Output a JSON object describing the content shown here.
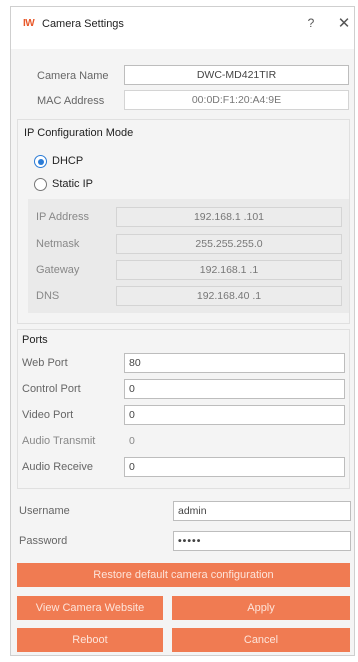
{
  "window": {
    "logo": "IW",
    "title": "Camera Settings",
    "help_glyph": "?",
    "close_glyph": "✕"
  },
  "camera": {
    "name_label": "Camera Name",
    "name_value": "DWC-MD421TIR",
    "mac_label": "MAC Address",
    "mac_value": "00:0D:F1:20:A4:9E"
  },
  "ip_config": {
    "title": "IP Configuration Mode",
    "dhcp_label": "DHCP",
    "static_label": "Static IP",
    "selected": "DHCP",
    "fields": [
      {
        "label": "IP Address",
        "value": "192.168.1 .101"
      },
      {
        "label": "Netmask",
        "value": "255.255.255.0"
      },
      {
        "label": "Gateway",
        "value": "192.168.1 .1"
      },
      {
        "label": "DNS",
        "value": "192.168.40 .1"
      }
    ]
  },
  "ports": {
    "title": "Ports",
    "items": [
      {
        "label": "Web Port",
        "value": "80"
      },
      {
        "label": "Control Port",
        "value": "0"
      },
      {
        "label": "Video Port",
        "value": "0"
      },
      {
        "label": "Audio Transmit",
        "value": "0"
      },
      {
        "label": "Audio Receive",
        "value": "0"
      }
    ]
  },
  "credentials": {
    "username_label": "Username",
    "username_value": "admin",
    "password_label": "Password",
    "password_value": "•••••"
  },
  "buttons": {
    "restore": "Restore default camera configuration",
    "view_website": "View Camera Website",
    "apply": "Apply",
    "reboot": "Reboot",
    "cancel": "Cancel"
  },
  "colors": {
    "accent": "#f07b52",
    "radio_selected": "#2a7bd6"
  }
}
